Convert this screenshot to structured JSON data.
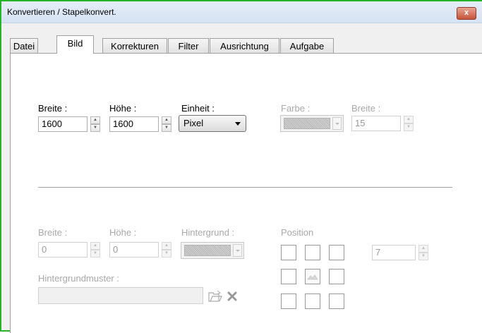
{
  "window": {
    "title": "Konvertieren / Stapelkonvert.",
    "close_label": "x"
  },
  "tabs": [
    {
      "label": "Datei"
    },
    {
      "label": "Bild"
    },
    {
      "label": "Korrekturen"
    },
    {
      "label": "Filter"
    },
    {
      "label": "Ausrichtung"
    },
    {
      "label": "Aufgabe"
    }
  ],
  "resize": {
    "width_label": "Breite :",
    "width_value": "1600",
    "height_label": "Höhe :",
    "height_value": "1600",
    "unit_label": "Einheit :",
    "unit_value": "Pixel"
  },
  "border": {
    "color_label": "Farbe :",
    "width_label": "Breite :",
    "width_value": "15"
  },
  "canvas": {
    "width_label": "Breite :",
    "width_value": "0",
    "height_label": "Höhe :",
    "height_value": "0",
    "background_label": "Hintergrund :",
    "pattern_label": "Hintergrundmuster :",
    "pattern_value": "",
    "position_label": "Position",
    "position_value": "7"
  }
}
